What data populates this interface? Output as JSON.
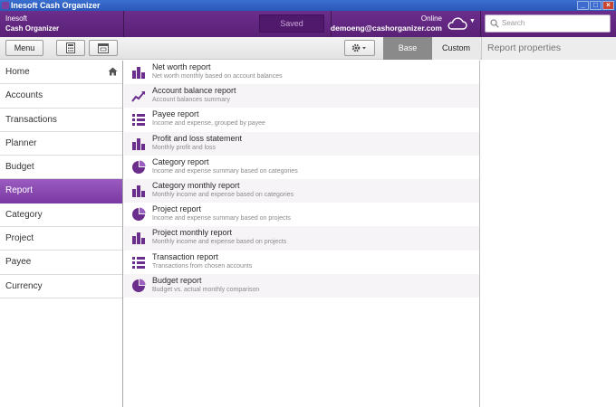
{
  "window": {
    "title": "Inesoft Cash Organizer"
  },
  "brand": {
    "company": "Inesoft",
    "product": "Cash Organizer"
  },
  "status": {
    "saved": "Saved"
  },
  "account": {
    "status": "Online",
    "email": "demoeng@cashorganizer.com"
  },
  "search": {
    "placeholder": "Search"
  },
  "toolbar": {
    "menu_label": "Menu",
    "tab_base": "Base",
    "tab_custom": "Custom",
    "properties_title": "Report properties"
  },
  "sidebar": {
    "items": [
      {
        "label": "Home"
      },
      {
        "label": "Accounts"
      },
      {
        "label": "Transactions"
      },
      {
        "label": "Planner"
      },
      {
        "label": "Budget"
      },
      {
        "label": "Report"
      },
      {
        "label": "Category"
      },
      {
        "label": "Project"
      },
      {
        "label": "Payee"
      },
      {
        "label": "Currency"
      }
    ],
    "active": "Report"
  },
  "reports": [
    {
      "title": "Net worth report",
      "desc": "Net worth monthly based on account balances",
      "icon": "bar-chart-icon"
    },
    {
      "title": "Account balance report",
      "desc": "Account balances summary",
      "icon": "trend-line-icon"
    },
    {
      "title": "Payee report",
      "desc": "Income and expense, grouped by payee",
      "icon": "list-icon"
    },
    {
      "title": "Profit and loss statement",
      "desc": "Monthly profit and loss",
      "icon": "bar-chart-icon"
    },
    {
      "title": "Category report",
      "desc": "Income and expense summary based on categories",
      "icon": "pie-chart-icon"
    },
    {
      "title": "Category monthly report",
      "desc": "Monthly income and expense based on categories",
      "icon": "bar-chart-icon"
    },
    {
      "title": "Project report",
      "desc": "Income and expense summary based on projects",
      "icon": "pie-chart-icon"
    },
    {
      "title": "Project monthly report",
      "desc": "Monthly income and expense based on projects",
      "icon": "bar-chart-icon"
    },
    {
      "title": "Transaction report",
      "desc": "Transactions from chosen accounts",
      "icon": "list-icon"
    },
    {
      "title": "Budget report",
      "desc": "Budget vs. actual monthly comparison",
      "icon": "pie-chart-icon"
    }
  ],
  "colors": {
    "accent": "#7b3aa3",
    "header": "#5a2176",
    "icon": "#6b2e8c"
  }
}
